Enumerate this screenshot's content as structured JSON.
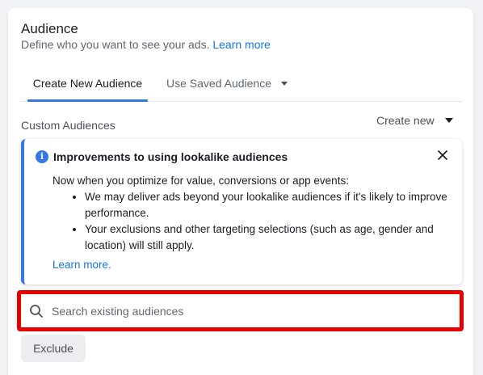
{
  "section": {
    "title": "Audience",
    "subtitle": "Define who you want to see your ads.",
    "learn_more": "Learn more"
  },
  "tabs": [
    {
      "label": "Create New Audience",
      "active": true
    },
    {
      "label": "Use Saved Audience",
      "active": false
    }
  ],
  "custom_audiences": {
    "label": "Custom Audiences",
    "create_new_label": "Create new"
  },
  "notice": {
    "title": "Improvements to using lookalike audiences",
    "intro": "Now when you optimize for value, conversions or app events:",
    "bullets": [
      "We may deliver ads beyond your lookalike audiences if it's likely to improve performance.",
      "Your exclusions and other targeting selections (such as age, gender and location) will still apply."
    ],
    "learn_more": "Learn more."
  },
  "search": {
    "placeholder": "Search existing audiences",
    "value": ""
  },
  "exclude_label": "Exclude",
  "colors": {
    "accent": "#3578e5",
    "link": "#1a73e8",
    "highlight": "#e60000"
  },
  "icons": {
    "info": "info-icon",
    "close": "close-icon",
    "search": "search-icon",
    "dropdown": "caret-down-icon"
  }
}
